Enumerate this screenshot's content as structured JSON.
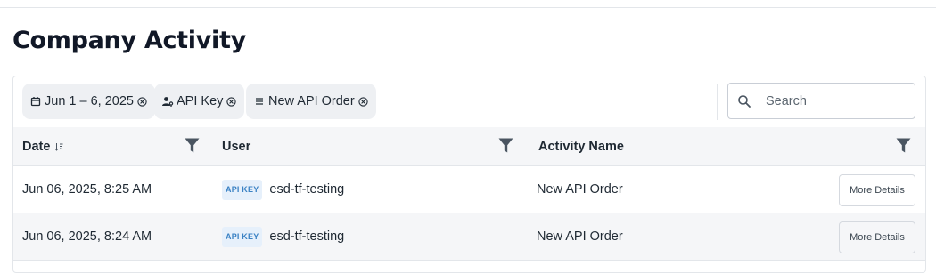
{
  "page": {
    "title": "Company Activity"
  },
  "filters": {
    "date": {
      "label": "Jun 1 – 6, 2025",
      "icon": "calendar-icon"
    },
    "user_type": {
      "label": "API Key",
      "icon": "user-key-icon"
    },
    "activity": {
      "label": "New API Order",
      "icon": "list-icon"
    }
  },
  "search": {
    "placeholder": "Search",
    "value": ""
  },
  "table": {
    "columns": {
      "date": "Date",
      "user": "User",
      "activity": "Activity Name"
    },
    "rows": [
      {
        "date": "Jun 06, 2025, 8:25 AM",
        "badge": "API KEY",
        "user": "esd-tf-testing",
        "activity": "New API Order",
        "action": "More Details"
      },
      {
        "date": "Jun 06, 2025, 8:24 AM",
        "badge": "API KEY",
        "user": "esd-tf-testing",
        "activity": "New API Order",
        "action": "More Details"
      }
    ]
  },
  "colors": {
    "chip_bg": "#eef0f3",
    "header_bg": "#f5f6f8",
    "badge_bg": "#e6f0fb",
    "badge_text": "#3b82c4",
    "filter_icon": "#4a5561"
  }
}
